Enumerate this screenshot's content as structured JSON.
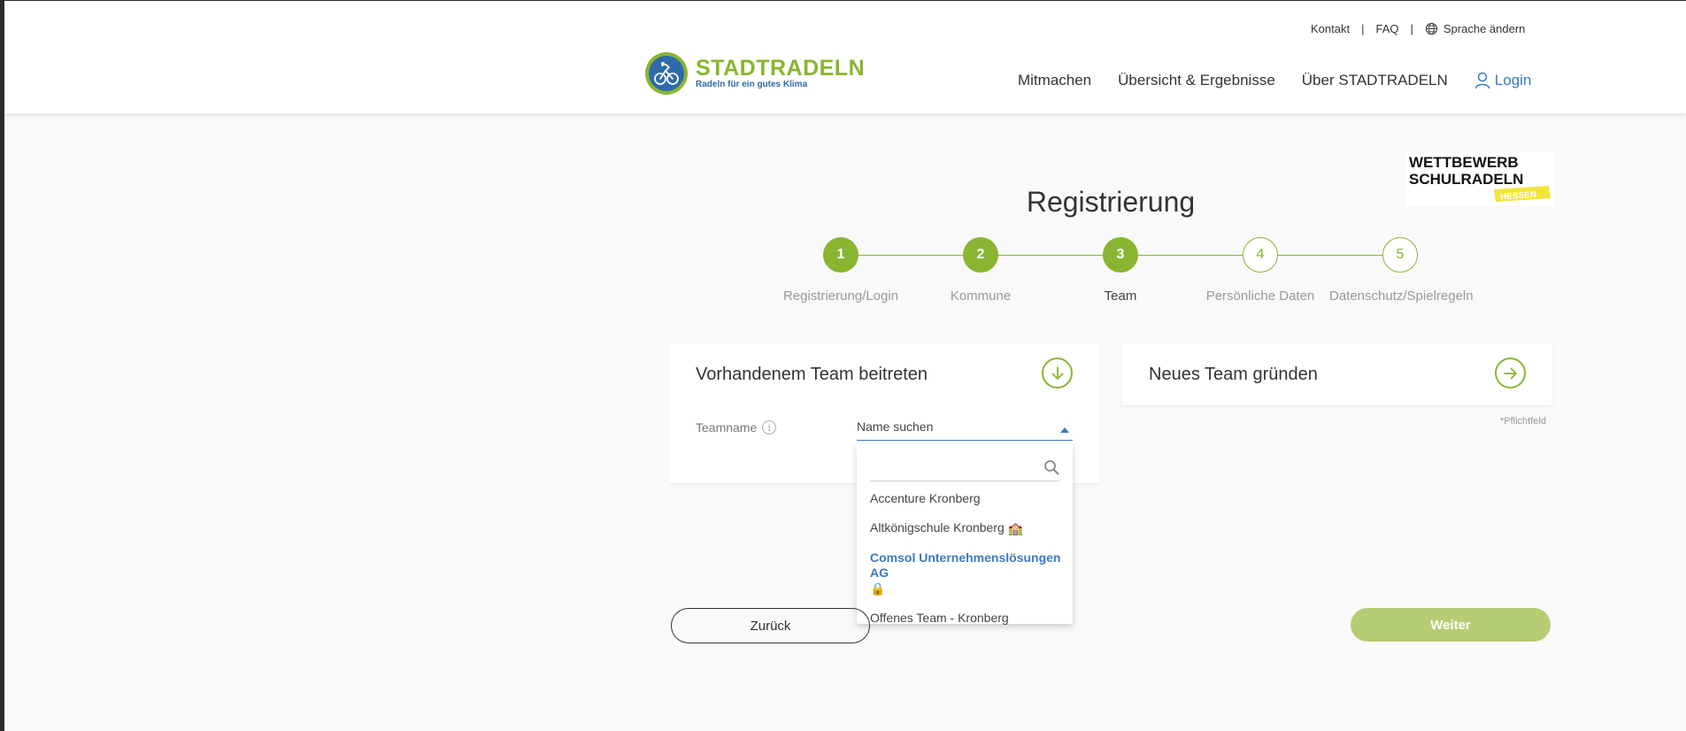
{
  "header": {
    "util_nav": {
      "contact": "Kontakt",
      "faq": "FAQ",
      "separator": "|",
      "language": "Sprache ändern",
      "language_icon": "globe-icon"
    },
    "logo": {
      "title": "STADTRADELN",
      "subtitle": "Radeln für ein gutes Klima"
    },
    "main_nav": [
      {
        "label": "Mitmachen"
      },
      {
        "label": "Übersicht & Ergebnisse"
      },
      {
        "label": "Über STADTRADELN"
      }
    ],
    "login": {
      "label": "Login",
      "icon": "user-icon"
    }
  },
  "badge": {
    "line1": "WETTBEWERB",
    "line2": "SCHULRADELN",
    "line3": "HESSEN"
  },
  "page_title": "Registrierung",
  "stepper": {
    "current": 3,
    "steps": [
      {
        "number": "1",
        "label": "Registrierung/Login",
        "state": "done"
      },
      {
        "number": "2",
        "label": "Kommune",
        "state": "done"
      },
      {
        "number": "3",
        "label": "Team",
        "state": "active"
      },
      {
        "number": "4",
        "label": "Persönliche Daten",
        "state": "todo"
      },
      {
        "number": "5",
        "label": "Datenschutz/Spielregeln",
        "state": "todo"
      }
    ]
  },
  "join_card": {
    "title": "Vorhandenem Team beitreten",
    "icon": "arrow-down-circle-icon",
    "field_label": "Teamname",
    "info_icon": "i",
    "select_placeholder": "Name suchen"
  },
  "new_card": {
    "title": "Neues Team gründen",
    "icon": "arrow-right-circle-icon"
  },
  "required_note": "*Pflichtfeld",
  "dropdown": {
    "search_value": "",
    "search_icon": "search-icon",
    "options": [
      {
        "label": "Accenture Kronberg",
        "emoji": ""
      },
      {
        "label": "Altkönigschule Kronberg",
        "emoji": "🏫"
      },
      {
        "label": "Comsol Unternehmenslösungen AG",
        "emoji": "🔒",
        "highlighted": true
      },
      {
        "label": "Offenes Team - Kronberg",
        "emoji": ""
      }
    ]
  },
  "buttons": {
    "back": "Zurück",
    "next": "Weiter"
  },
  "colors": {
    "brand_green": "#8ab531",
    "brand_blue": "#2e6ba8",
    "link_blue": "#3a7bbf",
    "next_button": "#b6cd73"
  }
}
